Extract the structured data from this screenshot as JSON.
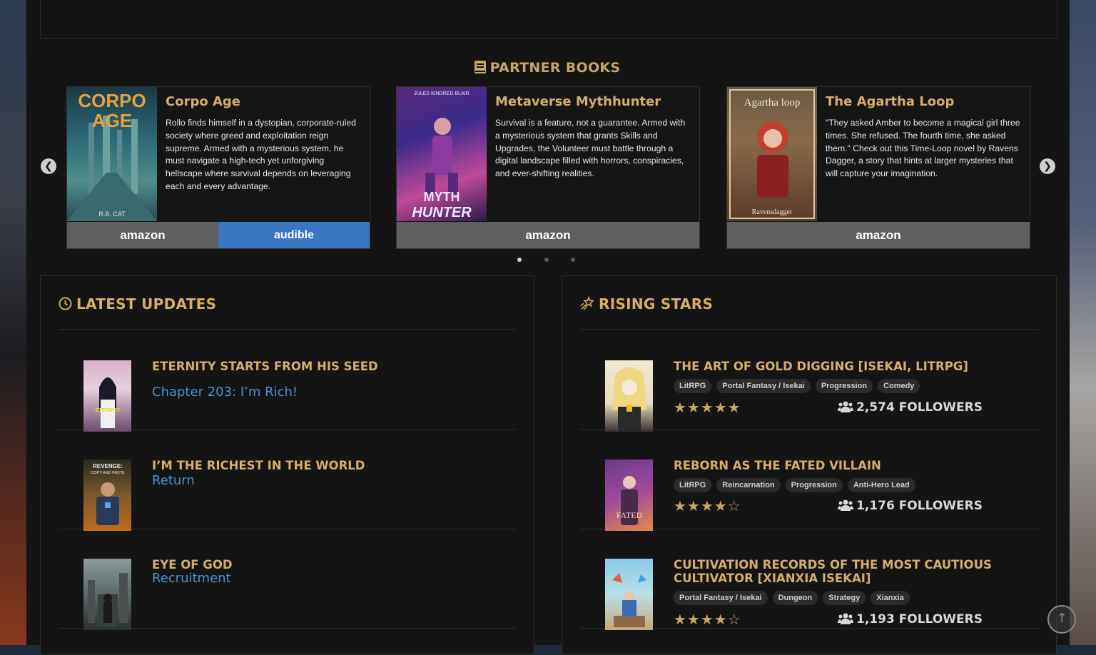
{
  "partner_books": {
    "title": "PARTNER BOOKS",
    "books": [
      {
        "title": "Corpo Age",
        "cover_text": "CORPO AGE",
        "cover_author": "R.B. CAT",
        "description": "Rollo finds himself in a dystopian, corporate-ruled society where greed and exploitation reign supreme. Armed with a mysterious system, he must navigate a high-tech yet unforgiving hellscape where survival depends on leveraging each and every advantage.",
        "amazon_label": "amazon",
        "audible_label": "audible"
      },
      {
        "title": "Metaverse Mythhunter",
        "cover_text": "MYTH HUNTER",
        "cover_author": "JULES KINDRED BLAIR",
        "description": "Survival is a feature, not a guarantee. Armed with a mysterious system that grants Skills and Upgrades, the Volunteer must battle through a digital landscape filled with horrors, conspiracies, and ever-shifting realities.",
        "amazon_label": "amazon"
      },
      {
        "title": "The Agartha Loop",
        "cover_text": "The Agartha loop",
        "cover_author": "Ravensdagger",
        "description": "\"They asked Amber to become a magical girl three times. She refused. The fourth time, she asked them.\" Check out this Time-Loop novel by Ravens Dagger, a story that hints at larger mysteries that will capture your imagination.",
        "amazon_label": "amazon"
      }
    ],
    "prev_icon": "chevron-left-icon",
    "next_icon": "chevron-right-icon",
    "active_dot": 0
  },
  "latest_updates": {
    "title": "LATEST UPDATES",
    "items": [
      {
        "title": "ETERNITY STARTS FROM HIS SEED",
        "chapter": "Chapter 203: I’m Rich!"
      },
      {
        "title": "I’M THE RICHEST IN THE WORLD",
        "chapter": "Return",
        "cover_text": "REVENGE: COPY AND PASTE"
      },
      {
        "title": "EYE OF GOD",
        "chapter": "Recruitment"
      }
    ]
  },
  "rising_stars": {
    "title": "RISING STARS",
    "items": [
      {
        "title": "THE ART OF GOLD DIGGING [ISEKAI, LITRPG]",
        "tags": [
          "LitRPG",
          "Portal Fantasy / Isekai",
          "Progression",
          "Comedy"
        ],
        "rating": 5,
        "stars": "★★★★★",
        "followers": "2,574 FOLLOWERS"
      },
      {
        "title": "REBORN AS THE FATED VILLAIN",
        "tags": [
          "LitRPG",
          "Reincarnation",
          "Progression",
          "Anti-Hero Lead"
        ],
        "rating": 4.5,
        "stars": "★★★★☆",
        "followers": "1,176 FOLLOWERS"
      },
      {
        "title": "CULTIVATION RECORDS OF THE MOST CAUTIOUS CULTIVATOR [XIANXIA ISEKAI]",
        "tags": [
          "Portal Fantasy / Isekai",
          "Dungeon",
          "Strategy",
          "Xianxia"
        ],
        "rating": 4.5,
        "stars": "★★★★☆",
        "followers": "1,193 FOLLOWERS"
      }
    ]
  },
  "colors": {
    "accent_gold": "#d6ad6b",
    "link_blue": "#4a8fd6",
    "amazon_btn": "#5d5f61",
    "audible_btn": "#3a77c0"
  }
}
